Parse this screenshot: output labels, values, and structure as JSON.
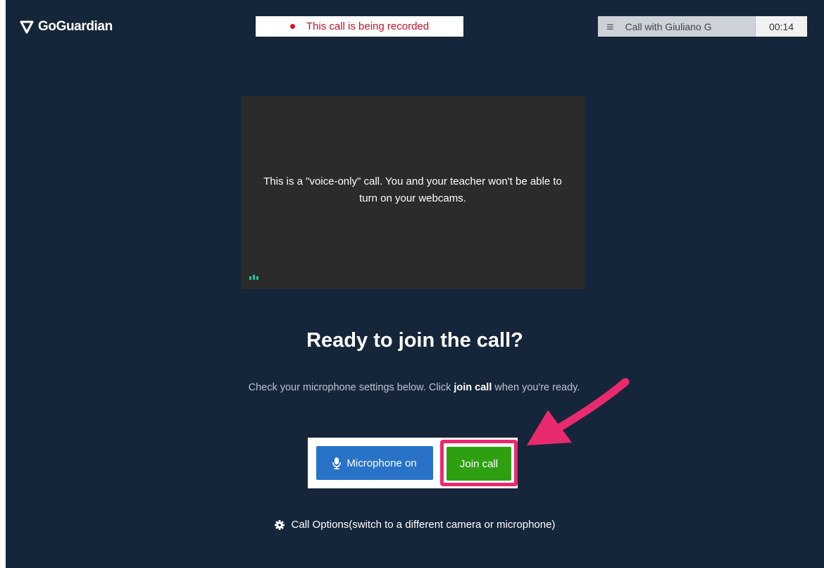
{
  "header": {
    "logo_text": "GoGuardian",
    "recording_banner": "This call is being recorded",
    "call_title": "Call with Giuliano G",
    "timer": "00:14"
  },
  "video": {
    "message": "This is a \"voice-only\" call. You and your teacher won't be able to turn on your webcams."
  },
  "join": {
    "heading": "Ready to join the call?",
    "instructions_before": "Check your microphone settings below. Click ",
    "instructions_bold": "join call",
    "instructions_after": " when you're ready.",
    "mic_button_label": "Microphone on",
    "join_button_label": "Join call",
    "call_options_label": "Call Options(switch to a different camera or microphone)"
  },
  "colors": {
    "background": "#16263a",
    "mic_button": "#2872c8",
    "join_button": "#2f9f12",
    "annotation_arrow": "#ea2a6e",
    "recording_text": "#c0112a"
  },
  "icons": [
    "shield-logo-icon",
    "recording-dot-icon",
    "menu-icon",
    "audio-level-icon",
    "microphone-icon",
    "gear-icon",
    "annotation-arrow"
  ]
}
